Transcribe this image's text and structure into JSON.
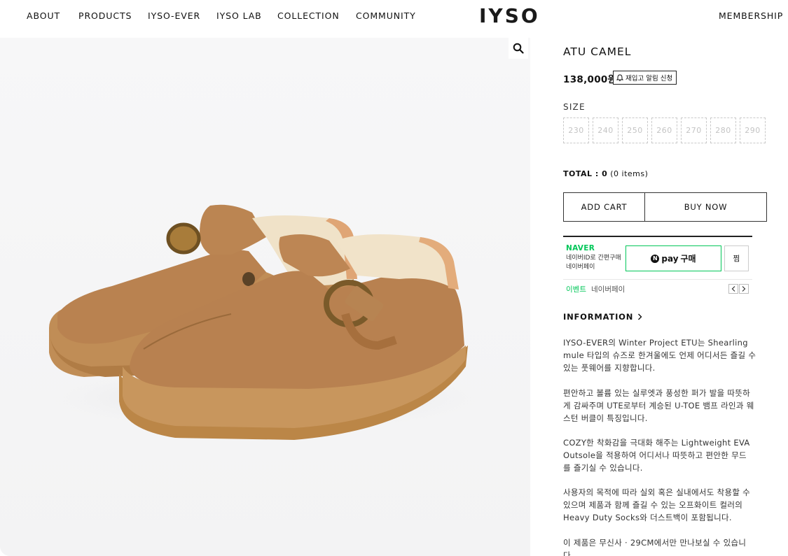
{
  "nav": {
    "left_items": [
      "ABOUT",
      "PRODUCTS",
      "IYSO-EVER",
      "IYSO LAB",
      "COLLECTION",
      "COMMUNITY"
    ],
    "logo": "IYSO",
    "right_item": "MEMBERSHIP"
  },
  "product": {
    "title": "ATU CAMEL",
    "price": "138,000원",
    "restock_label": "재입고 알림 신청",
    "size_label": "SIZE",
    "sizes": [
      "230",
      "240",
      "250",
      "260",
      "270",
      "280",
      "290"
    ],
    "total_label": "TOTAL : ",
    "total_value": "0",
    "total_items": " (0 items)",
    "add_cart": "ADD CART",
    "buy_now": "BUY NOW"
  },
  "npay": {
    "brand": "NAVER",
    "desc_line1": "네이버ID로 간편구매",
    "desc_line2": "네이버페이",
    "pay_label": "pay",
    "buy_label": "구매",
    "zzim": "찜",
    "event_label": "이벤트",
    "event_text": "네이버페이"
  },
  "info": {
    "label": "INFORMATION",
    "paragraphs": [
      [
        "IYSO-EVER의 Winter Project ETU는 Shearling",
        "mule 타입의 슈즈로 한겨울에도 언제 어디서든 즐길 수",
        "있는 풋웨어를 지향합니다."
      ],
      [
        "편안하고 볼륨 있는 실루엣과 풍성한 퍼가 발을 따뜻하",
        "게 감싸주며 UTE로부터 계승된 U-TOE 뱀프 라인과 웨",
        "스턴 버클이 특징입니다."
      ],
      [
        "COZY한 착화감을 극대화 해주는 Lightweight EVA",
        "Outsole을 적용하여 어디서나 따뜻하고 편안한 무드",
        "를 즐기실 수 있습니다."
      ],
      [
        "사용자의 목적에 따라 실외 혹은 실내에서도 착용할 수",
        "있으며 제품과 함께 즐길 수 있는 오프화이트 컬러의",
        "Heavy Duty Socks와 더스트백이 포함됩니다."
      ],
      [
        "이 제품은 무신사 · 29CM에서만 만나보실 수 있습니",
        "다."
      ]
    ]
  },
  "colors": {
    "naver_green": "#03c75a",
    "shoe_suede": "#b8824e",
    "shoe_sole": "#c28d52",
    "shearling": "#f1e3c9",
    "buckle": "#7a5a2a"
  },
  "icons": {
    "zoom": "magnifier-icon",
    "restock": "bell-icon",
    "info": "chevron-right-icon"
  }
}
